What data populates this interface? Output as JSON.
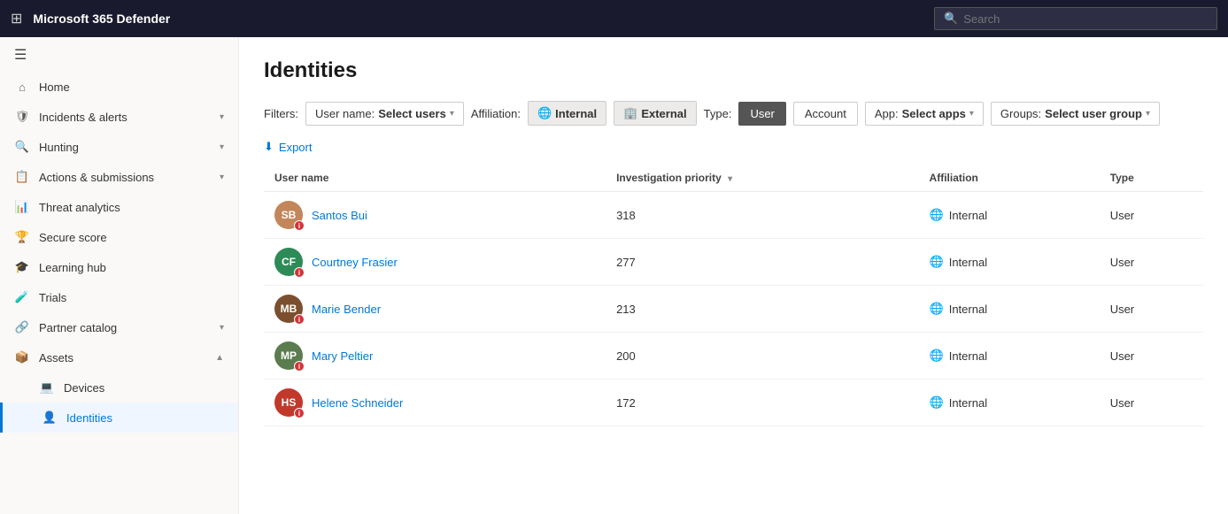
{
  "topbar": {
    "title": "Microsoft 365 Defender",
    "search_placeholder": "Search"
  },
  "sidebar": {
    "collapse_icon": "☰",
    "items": [
      {
        "id": "home",
        "label": "Home",
        "icon": "⌂",
        "has_chevron": false
      },
      {
        "id": "incidents-alerts",
        "label": "Incidents & alerts",
        "icon": "🛡",
        "has_chevron": true
      },
      {
        "id": "hunting",
        "label": "Hunting",
        "icon": "🔍",
        "has_chevron": true
      },
      {
        "id": "actions-submissions",
        "label": "Actions & submissions",
        "icon": "📋",
        "has_chevron": true
      },
      {
        "id": "threat-analytics",
        "label": "Threat analytics",
        "icon": "📊",
        "has_chevron": false
      },
      {
        "id": "secure-score",
        "label": "Secure score",
        "icon": "🏆",
        "has_chevron": false
      },
      {
        "id": "learning-hub",
        "label": "Learning hub",
        "icon": "🎓",
        "has_chevron": false
      },
      {
        "id": "trials",
        "label": "Trials",
        "icon": "🧪",
        "has_chevron": false
      },
      {
        "id": "partner-catalog",
        "label": "Partner catalog",
        "icon": "🔗",
        "has_chevron": true
      },
      {
        "id": "assets",
        "label": "Assets",
        "icon": "📦",
        "has_chevron": true,
        "expanded": true
      },
      {
        "id": "devices",
        "label": "Devices",
        "icon": "💻",
        "has_chevron": false,
        "indented": true
      },
      {
        "id": "identities",
        "label": "Identities",
        "icon": "👤",
        "has_chevron": false,
        "indented": true,
        "active": true
      }
    ]
  },
  "page": {
    "title": "Identities",
    "filters_label": "Filters:",
    "username_filter_label": "User name:",
    "username_filter_value": "Select users",
    "affiliation_label": "Affiliation:",
    "affiliation_internal": "Internal",
    "affiliation_external": "External",
    "type_label": "Type:",
    "type_user": "User",
    "type_account": "Account",
    "app_label": "App:",
    "app_value": "Select apps",
    "groups_label": "Groups:",
    "groups_value": "Select user group",
    "export_label": "Export",
    "table": {
      "columns": [
        {
          "id": "username",
          "label": "User name"
        },
        {
          "id": "investigation_priority",
          "label": "Investigation priority",
          "sortable": true
        },
        {
          "id": "affiliation",
          "label": "Affiliation"
        },
        {
          "id": "type",
          "label": "Type"
        }
      ],
      "rows": [
        {
          "id": 1,
          "name": "Santos Bui",
          "initials": "SB",
          "avatar_color": "#c3855a",
          "priority": "318",
          "affiliation": "Internal",
          "type": "User"
        },
        {
          "id": 2,
          "name": "Courtney Frasier",
          "initials": "CF",
          "avatar_color": "#2e8b57",
          "priority": "277",
          "affiliation": "Internal",
          "type": "User"
        },
        {
          "id": 3,
          "name": "Marie Bender",
          "initials": "MB",
          "avatar_color": "#7b4f2e",
          "priority": "213",
          "affiliation": "Internal",
          "type": "User"
        },
        {
          "id": 4,
          "name": "Mary Peltier",
          "initials": "MP",
          "avatar_color": "#5b7c4f",
          "priority": "200",
          "affiliation": "Internal",
          "type": "User"
        },
        {
          "id": 5,
          "name": "Helene Schneider",
          "initials": "HS",
          "avatar_color": "#c0392b",
          "priority": "172",
          "affiliation": "Internal",
          "type": "User"
        }
      ]
    }
  }
}
